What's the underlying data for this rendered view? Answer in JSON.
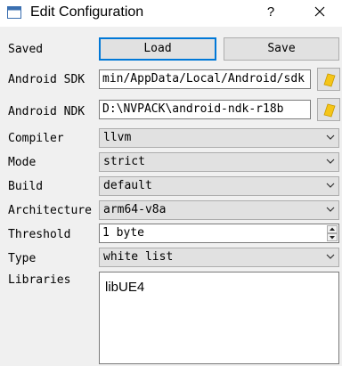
{
  "window": {
    "title": "Edit Configuration",
    "help_label": "?"
  },
  "icons": {
    "app": "window-icon",
    "close": "close-icon",
    "folder": "folder-icon",
    "dropdown": "chevron-down-icon"
  },
  "colors": {
    "accent": "#0078d7",
    "folder": "#f5c518",
    "button": "#e1e1e1"
  },
  "saved": {
    "label": "Saved",
    "load_label": "Load",
    "save_label": "Save"
  },
  "sdk": {
    "label": "Android SDK",
    "value": "min/AppData/Local/Android/sdk"
  },
  "ndk": {
    "label": "Android NDK",
    "value": "D:\\NVPACK\\android-ndk-r18b"
  },
  "compiler": {
    "label": "Compiler",
    "value": "llvm"
  },
  "mode": {
    "label": "Mode",
    "value": "strict"
  },
  "build": {
    "label": "Build",
    "value": "default"
  },
  "architecture": {
    "label": "Architecture",
    "value": "arm64-v8a"
  },
  "threshold": {
    "label": "Threshold",
    "value": "1 byte"
  },
  "type": {
    "label": "Type",
    "value": "white list"
  },
  "libraries": {
    "label": "Libraries",
    "items": [
      "libUE4"
    ]
  }
}
